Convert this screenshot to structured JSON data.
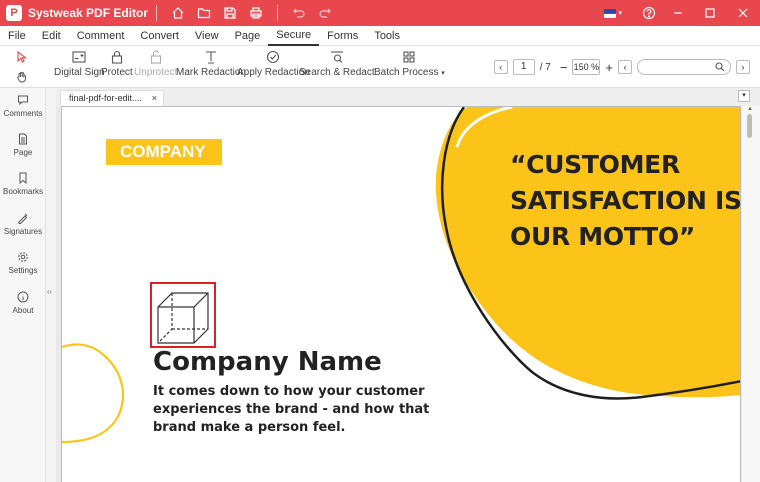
{
  "app": {
    "title": "Systweak PDF Editor",
    "logo_letter": "P",
    "accent_color": "#e8474d"
  },
  "titlebar_icons": [
    "home-icon",
    "folder-icon",
    "save-icon",
    "print-icon",
    "undo-icon",
    "redo-icon"
  ],
  "window_icons": [
    "flag-icon",
    "help-icon",
    "minimize-icon",
    "maximize-icon",
    "close-icon"
  ],
  "menu": {
    "items": [
      "File",
      "Edit",
      "Comment",
      "Convert",
      "View",
      "Page",
      "Secure",
      "Forms",
      "Tools"
    ],
    "active": "Secure"
  },
  "toolbar": {
    "digital_sign": "Digital Sign",
    "protect": "Protect",
    "unprotect": "Unprotect",
    "mark_redaction": "Mark Redaction",
    "apply_redaction": "Apply Redaction",
    "search_redact": "Search & Redact",
    "batch_process": "Batch Process"
  },
  "navigation": {
    "current_page": "1",
    "total_pages": "/ 7",
    "zoom": "150 %",
    "search_placeholder": ""
  },
  "sidebar": {
    "items": [
      "Comments",
      "Page",
      "Bookmarks",
      "Signatures",
      "Settings",
      "About"
    ]
  },
  "tab": {
    "name": "final-pdf-for-edit....",
    "close": "×"
  },
  "document": {
    "company_tag": "COMPANY",
    "quote": "“CUSTOMER SATISFACTION IS OUR MOTTO”",
    "company_name": "Company Name",
    "tagline": "It comes down to how your customer experiences the brand - and how that brand make a person feel.",
    "brand_color": "#fcc419",
    "selection_color": "#e02020"
  }
}
